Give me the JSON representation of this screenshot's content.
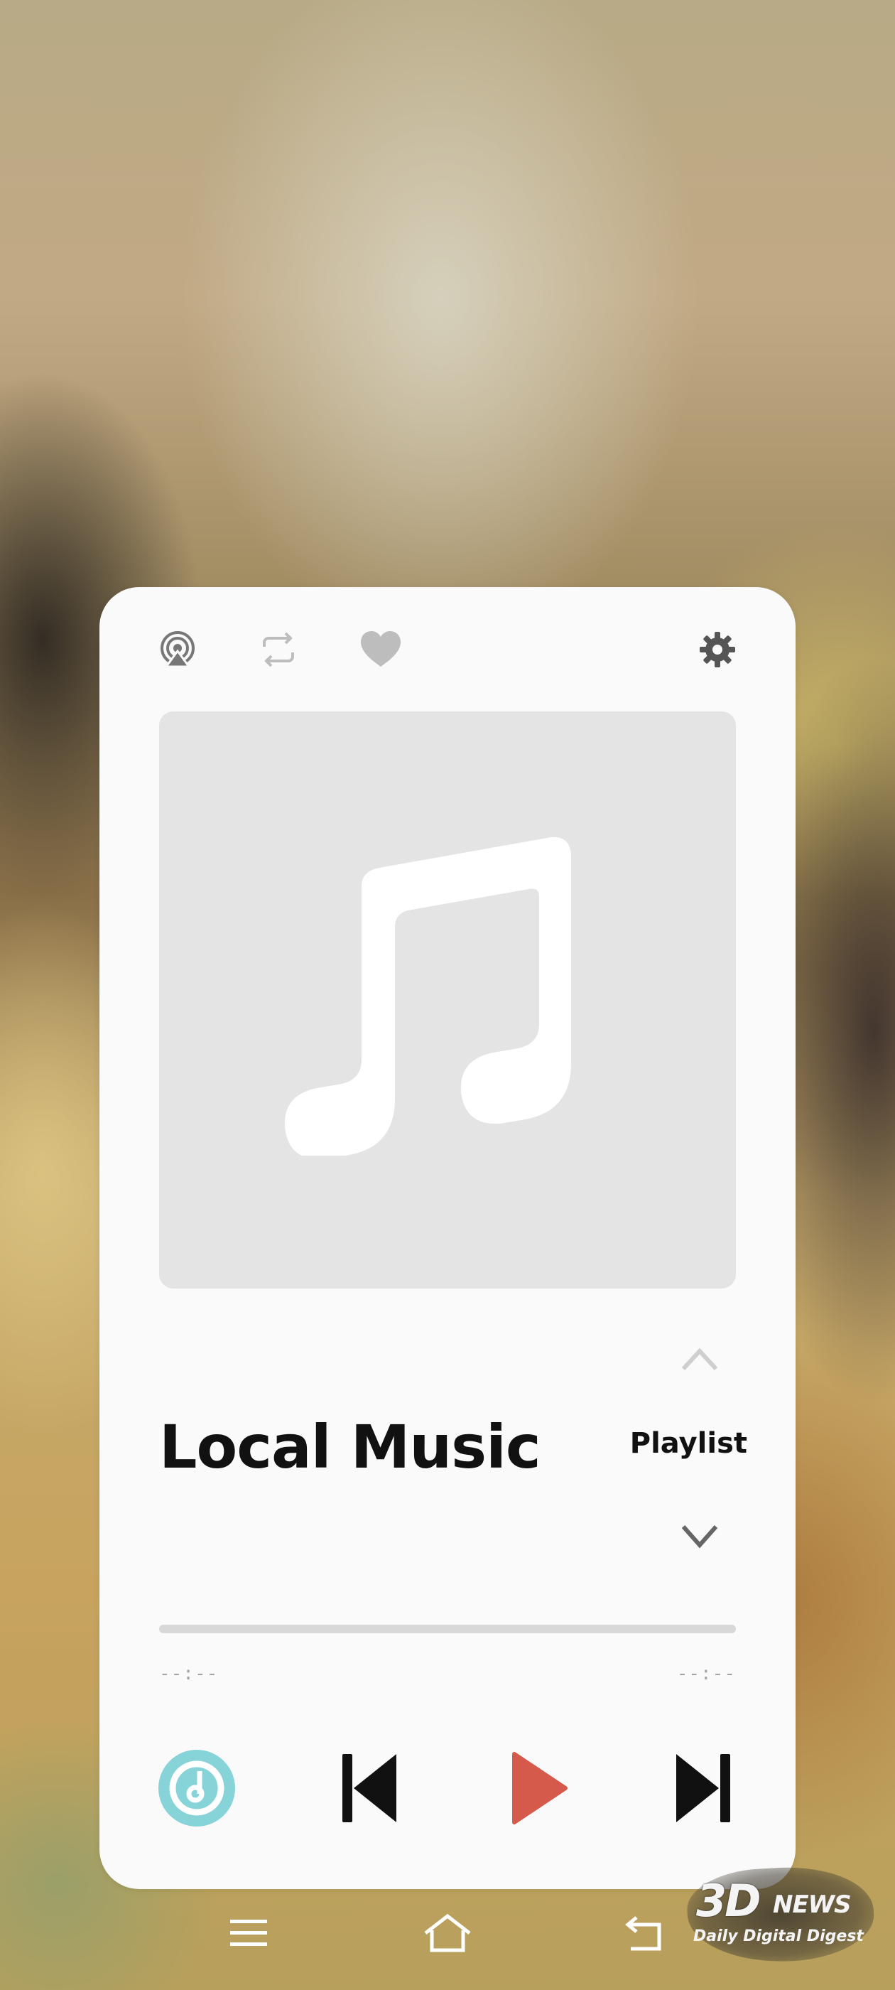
{
  "player": {
    "title": "Local Music",
    "playlist_label": "Playlist",
    "time_elapsed": "--:--",
    "time_total": "--:--",
    "progress": 0
  },
  "icons": {
    "top_bar": [
      "airplay-icon",
      "repeat-icon",
      "heart-icon",
      "gear-icon"
    ],
    "controls": [
      "music-app-icon",
      "skip-previous-icon",
      "play-icon",
      "skip-next-icon"
    ],
    "nav": [
      "menu-icon",
      "home-icon",
      "back-icon"
    ]
  },
  "colors": {
    "accent_teal": "#86d3d8",
    "play_red": "#d65a4c",
    "icon_gray": "#777777",
    "icon_light": "#bdbdbd",
    "art_bg": "#e4e4e4"
  },
  "watermark": {
    "logo": "3D",
    "brand": "NEWS",
    "tagline": "Daily Digital Digest"
  }
}
